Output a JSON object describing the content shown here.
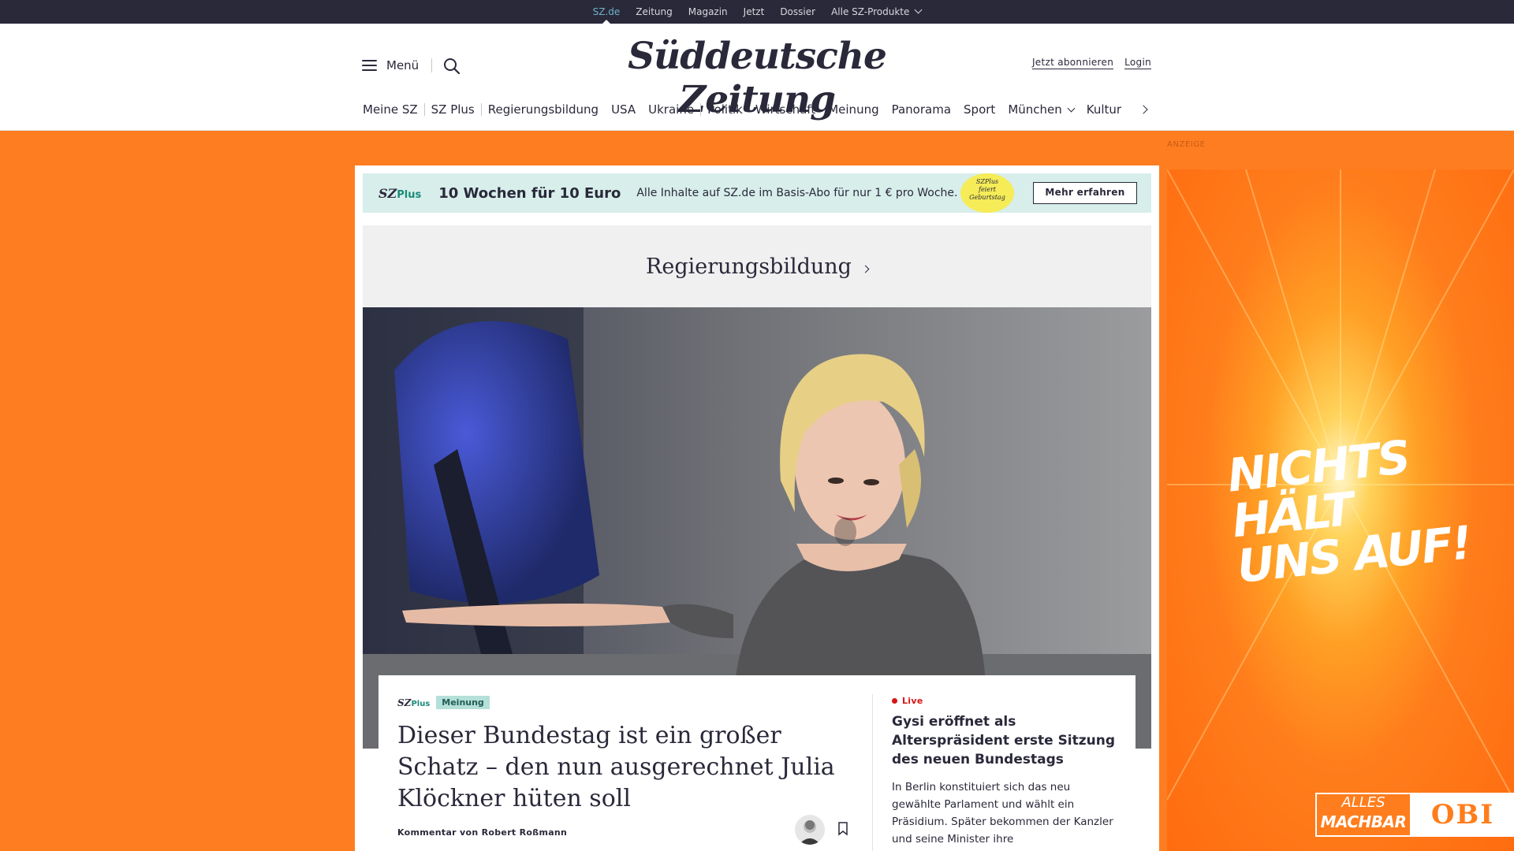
{
  "topbar": {
    "links": [
      "SZ.de",
      "Zeitung",
      "Magazin",
      "Jetzt",
      "Dossier",
      "Alle SZ-Produkte"
    ]
  },
  "header": {
    "menu_label": "Menü",
    "logo": "Süddeutsche Zeitung",
    "subscribe_label": "Jetzt abonnieren",
    "login_label": "Login"
  },
  "nav": {
    "items": [
      "Meine SZ",
      "SZ Plus",
      "Regierungsbildung",
      "USA",
      "Ukraine",
      "Politik",
      "Wirtschaft",
      "Meinung",
      "Panorama",
      "Sport",
      "München",
      "Kultur"
    ]
  },
  "ad_label": "ANZEIGE",
  "promo": {
    "brand": "SZ",
    "brand_plus": "Plus",
    "headline": "10 Wochen für 10 Euro",
    "sub": "Alle Inhalte auf SZ.de im Basis-Abo für nur 1 € pro Woche.",
    "badge_line1": "SZPlus",
    "badge_line2": "feiert",
    "badge_line3": "Geburtstag",
    "button": "Mehr erfahren"
  },
  "section": {
    "title": "Regierungsbildung"
  },
  "article": {
    "brand": "SZ",
    "brand_plus": "Plus",
    "tag": "Meinung",
    "title": "Dieser Bundestag ist ein großer Schatz – den nun ausgerechnet Julia Klöckner hüten soll",
    "byline": "Kommentar von Robert Roßmann"
  },
  "live": {
    "label": "Live",
    "title": "Gysi eröffnet als Alterspräsident erste Sitzung des neuen Bundestags",
    "text": "In Berlin konstituiert sich das neu gewählte Parlament und wählt ein Präsidium. Später bekommen der Kanzler und seine Minister ihre"
  },
  "ad": {
    "slogan_line1": "NICHTS HÄLT",
    "slogan_line2": "UNS AUF!",
    "brand_line1": "ALLES",
    "brand_line2": "MACHBAR",
    "brand_logo": "OBI"
  },
  "colors": {
    "dark": "#29293a",
    "background_orange": "#ff7d21",
    "accent_teal": "#1b8a78",
    "live_red": "#d51616"
  }
}
